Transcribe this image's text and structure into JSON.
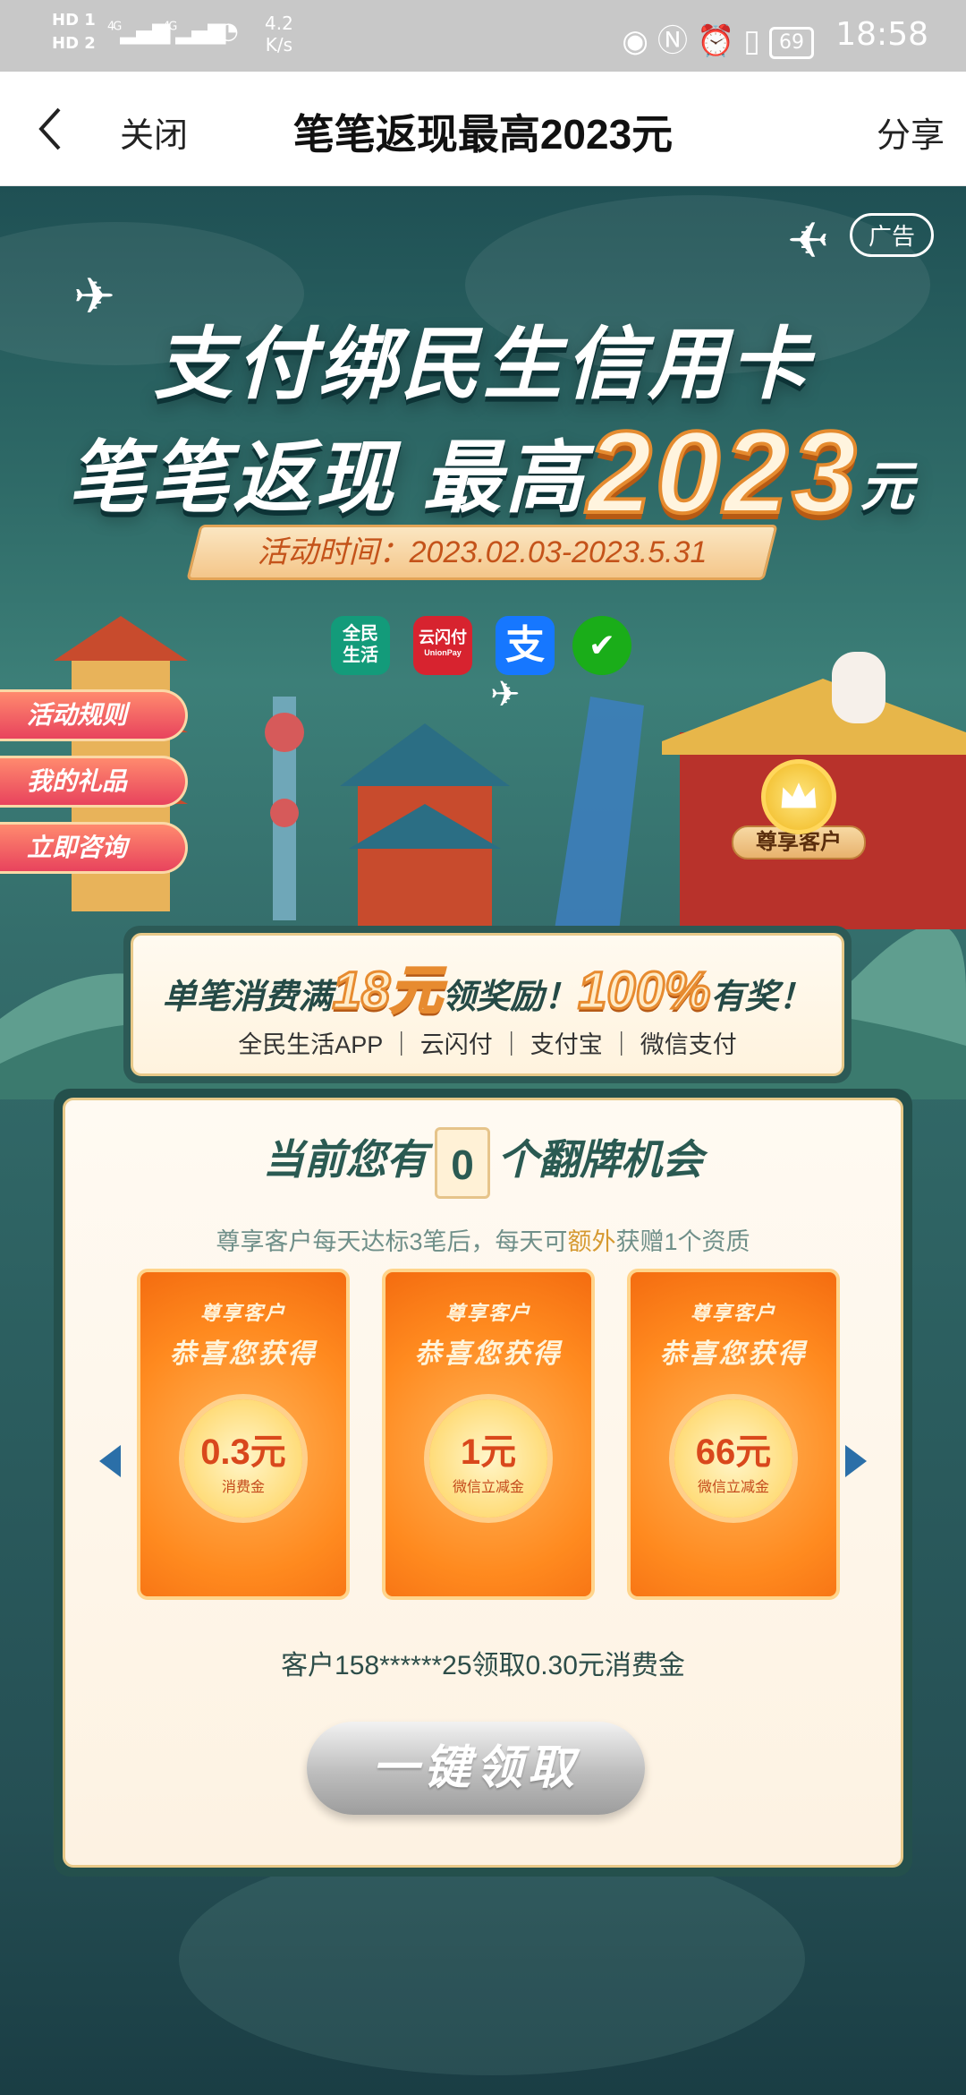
{
  "status_bar": {
    "hd1": "HD 1",
    "hd2": "HD 2",
    "net1": "4G",
    "net2": "4G",
    "speed_value": "4.2",
    "speed_unit": "K/s",
    "battery": "69",
    "time": "18:58",
    "icons": [
      "eye-icon",
      "nfc-icon",
      "alarm-icon",
      "vibrate-icon"
    ]
  },
  "header": {
    "close_label": "关闭",
    "title": "笔笔返现最高2023元",
    "share_label": "分享"
  },
  "banner": {
    "ad_badge": "广告",
    "headline_line1": "支付绑民生信用卡",
    "headline_line2_prefix": "笔笔返现 最高",
    "headline_amount": "2023",
    "headline_unit": "元",
    "period": "活动时间：2023.02.03-2023.5.31",
    "pay_apps": [
      {
        "name": "全民生活",
        "label_top": "全民",
        "label_bottom": "生活",
        "color": "#139b7a"
      },
      {
        "name": "云闪付",
        "label_top": "云闪付",
        "label_bottom": "UnionPay",
        "color": "#d7232f"
      },
      {
        "name": "支付宝",
        "label_top": "支",
        "label_bottom": "",
        "color": "#1677ff"
      },
      {
        "name": "微信",
        "label_top": "✔",
        "label_bottom": "",
        "color": "#1aad19"
      }
    ]
  },
  "side_buttons": [
    "活动规则",
    "我的礼品",
    "立即咨询"
  ],
  "vip_badge": "尊享客户",
  "promo": {
    "prefix": "单笔消费满",
    "amount": "18元",
    "middle": "领奖励！",
    "percent": "100%",
    "suffix": "有奖！",
    "channels": "全民生活APP ｜ 云闪付 ｜ 支付宝 ｜ 微信支付"
  },
  "panel": {
    "chance_prefix": "当前您有",
    "chance_count": "0",
    "chance_suffix": "个翻牌机会",
    "note_before": "尊享客户每天达标3笔后，每天可",
    "note_highlight": "额外",
    "note_after": "获赠1个资质",
    "cards": [
      {
        "tier": "尊享客户",
        "headline": "恭喜您获得",
        "amount": "0.3元",
        "type": "消费金"
      },
      {
        "tier": "尊享客户",
        "headline": "恭喜您获得",
        "amount": "1元",
        "type": "微信立减金"
      },
      {
        "tier": "尊享客户",
        "headline": "恭喜您获得",
        "amount": "66元",
        "type": "微信立减金"
      }
    ],
    "ticker": "客户158******25领取0.30元消费金",
    "claim_button": "一键领取"
  },
  "colors": {
    "bg_teal": "#2f6b68",
    "card_orange": "#ff8a1f",
    "side_btn_red": "#e8435d",
    "arrow_blue": "#2b6fa8"
  }
}
